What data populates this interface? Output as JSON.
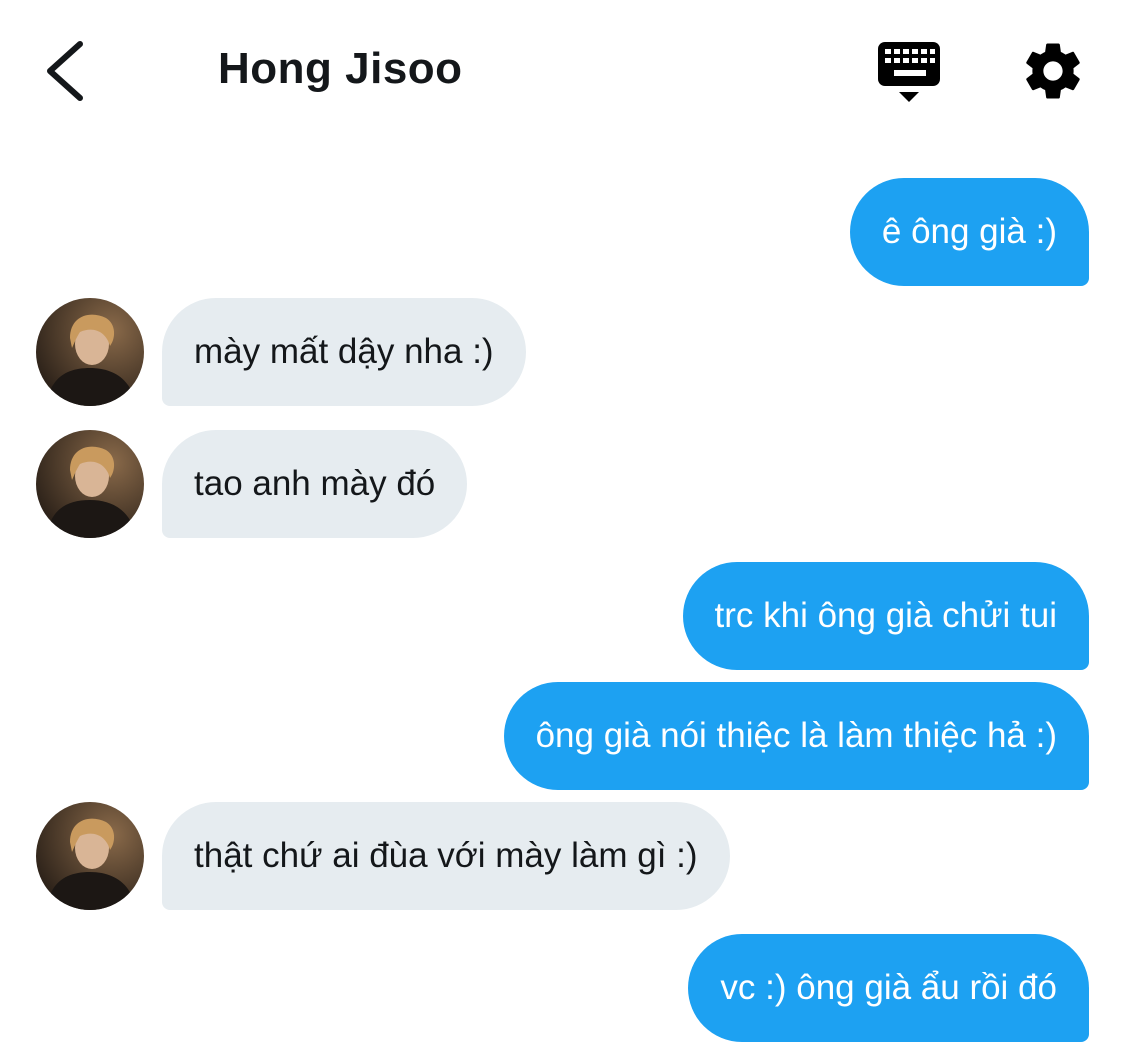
{
  "header": {
    "title": "Hong Jisoo",
    "back_icon": "chevron-left-icon",
    "keyboard_icon": "keyboard-icon",
    "settings_icon": "gear-icon"
  },
  "colors": {
    "sent_bubble": "#1da1f2",
    "received_bubble": "#e6ecf0",
    "text_dark": "#14171a"
  },
  "messages": [
    {
      "direction": "sent",
      "text": "ê ông già :)"
    },
    {
      "direction": "received",
      "text": "mày mất dậy nha :)"
    },
    {
      "direction": "received",
      "text": "tao anh mày đó"
    },
    {
      "direction": "sent",
      "text": "trc khi ông già chửi tui"
    },
    {
      "direction": "sent",
      "text": "ông già nói thiệc là làm thiệc hả :)"
    },
    {
      "direction": "received",
      "text": "thật chứ ai đùa với mày làm gì :)"
    },
    {
      "direction": "sent",
      "text": "vc :) ông già ẩu rồi đó"
    }
  ]
}
